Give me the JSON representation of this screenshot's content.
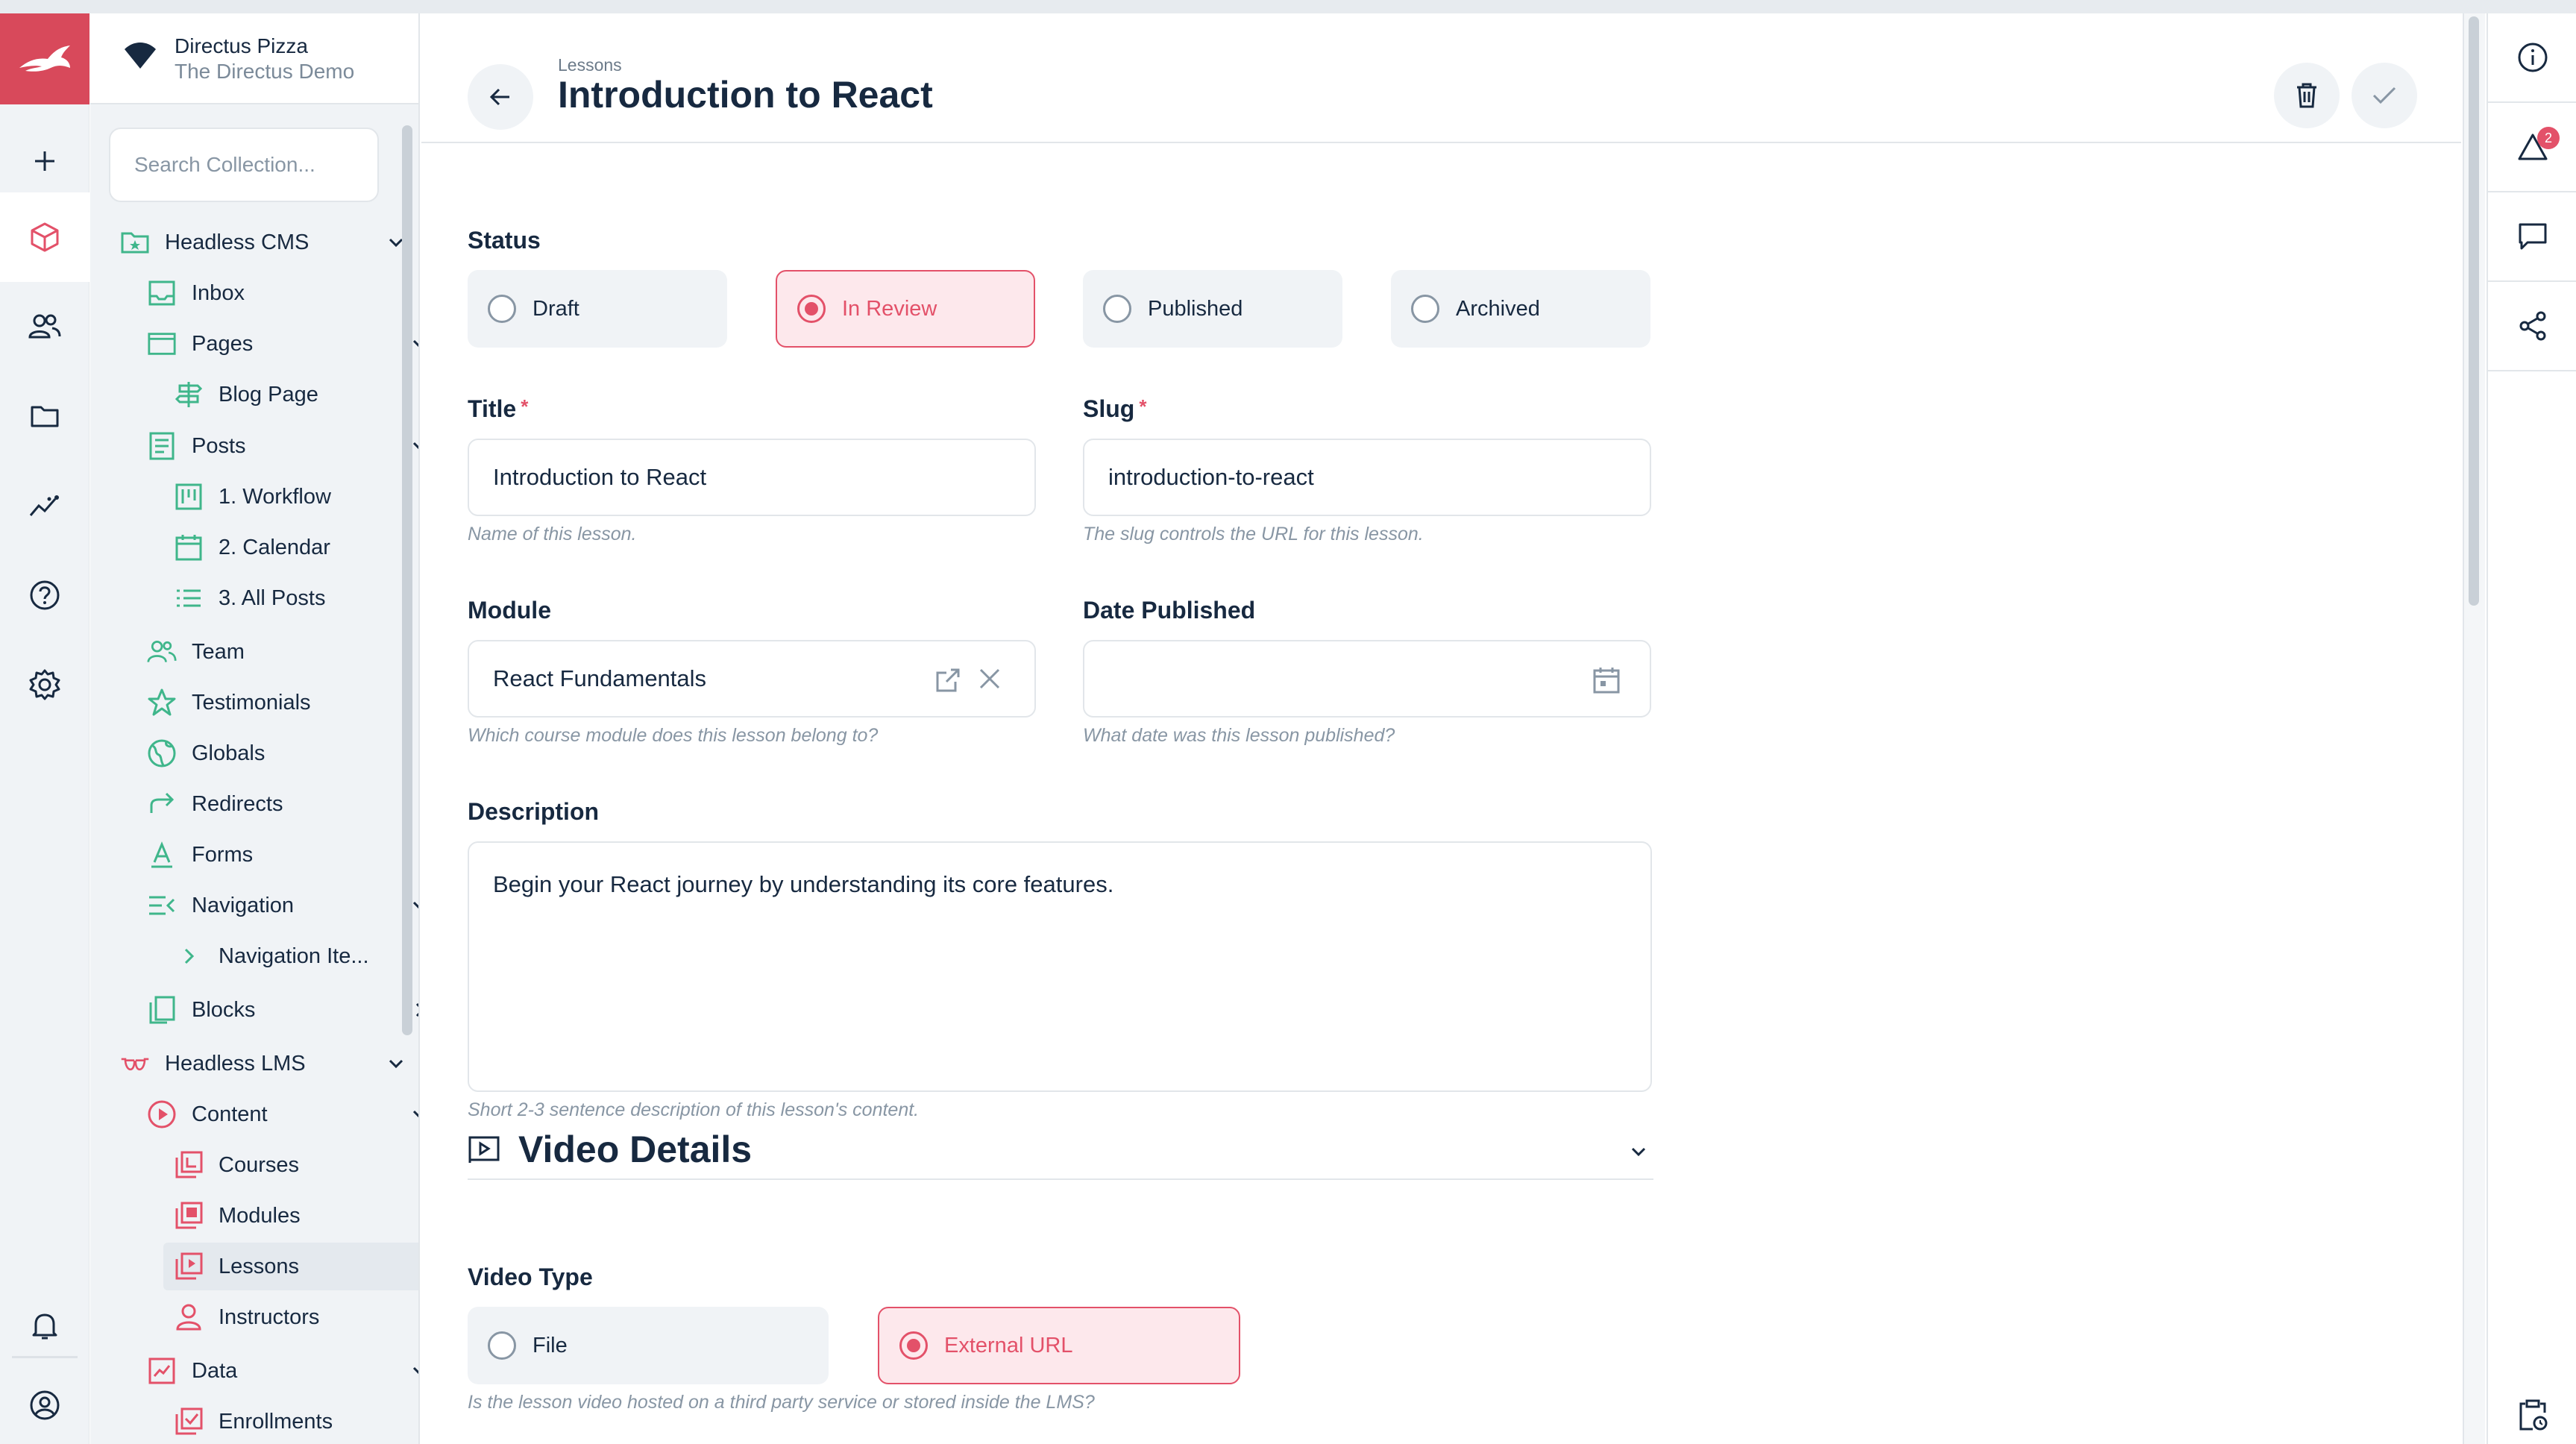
{
  "project": {
    "name": "Directus Pizza",
    "subtitle": "The Directus Demo"
  },
  "nav": {
    "search_placeholder": "Search Collection...",
    "items": [
      {
        "label": "Headless CMS"
      },
      {
        "label": "Inbox"
      },
      {
        "label": "Pages"
      },
      {
        "label": "Blog Page"
      },
      {
        "label": "Posts"
      },
      {
        "label": "1. Workflow"
      },
      {
        "label": "2. Calendar"
      },
      {
        "label": "3. All Posts"
      },
      {
        "label": "Team"
      },
      {
        "label": "Testimonials"
      },
      {
        "label": "Globals"
      },
      {
        "label": "Redirects"
      },
      {
        "label": "Forms"
      },
      {
        "label": "Navigation"
      },
      {
        "label": "Navigation Ite..."
      },
      {
        "label": "Blocks"
      },
      {
        "label": "Headless LMS"
      },
      {
        "label": "Content"
      },
      {
        "label": "Courses"
      },
      {
        "label": "Modules"
      },
      {
        "label": "Lessons"
      },
      {
        "label": "Instructors"
      },
      {
        "label": "Data"
      },
      {
        "label": "Enrollments"
      }
    ]
  },
  "header": {
    "breadcrumb": "Lessons",
    "title": "Introduction to React"
  },
  "form": {
    "status": {
      "label": "Status",
      "options": [
        "Draft",
        "In Review",
        "Published",
        "Archived"
      ],
      "selected": "In Review"
    },
    "title": {
      "label": "Title",
      "required_mark": "*",
      "value": "Introduction to React",
      "hint": "Name of this lesson."
    },
    "slug": {
      "label": "Slug",
      "required_mark": "*",
      "value": "introduction-to-react",
      "hint": "The slug controls the URL for this lesson."
    },
    "module": {
      "label": "Module",
      "value": "React Fundamentals",
      "hint": "Which course module does this lesson belong to?"
    },
    "date_published": {
      "label": "Date Published",
      "value": "",
      "hint": "What date was this lesson published?"
    },
    "description": {
      "label": "Description",
      "value": "Begin your React journey by understanding its core features.",
      "hint": "Short 2-3 sentence description of this lesson's content."
    },
    "video_section": {
      "title": "Video Details"
    },
    "video_type": {
      "label": "Video Type",
      "options": [
        "File",
        "External URL"
      ],
      "selected": "External URL",
      "hint": "Is the lesson video hosted on a third party service or stored inside the LMS?"
    }
  },
  "sidebar": {
    "notification_badge": "2"
  },
  "colors": {
    "brand": "#e35169",
    "logo_bg": "#d8495b",
    "nav_icon_cms": "#3fb68b",
    "nav_icon_lms": "#e35169"
  },
  "icons": [
    "rabbit-logo",
    "plus-icon",
    "cube-icon",
    "users-icon",
    "folder-icon",
    "insights-icon",
    "help-icon",
    "settings-icon",
    "bell-icon",
    "account-icon",
    "info-icon",
    "revisions-icon",
    "comments-icon",
    "share-icon",
    "clipboard-icon"
  ]
}
